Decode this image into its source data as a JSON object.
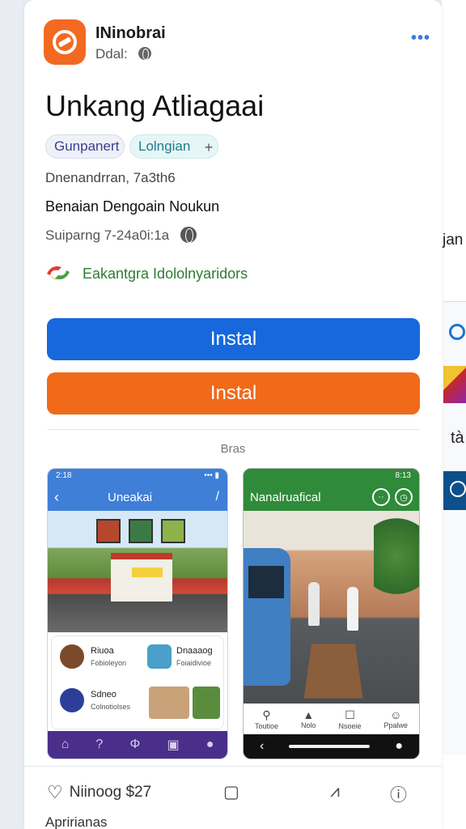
{
  "developer": {
    "name": "INinobrai",
    "subtitle": "Ddal:"
  },
  "menu": {
    "more_icon": "•••"
  },
  "app": {
    "title": "Unkang Atliagaai"
  },
  "tags": [
    "Gunpanert",
    "Lolngian"
  ],
  "tag_add": "+",
  "info": {
    "line_a": "Dnenandrran, 7a3th6",
    "line_b": "Benaian Dengoain Noukun",
    "line_c": "Suiparng 7-24a0i:1a"
  },
  "partner": {
    "text": "Eakantgra Idololnyaridors"
  },
  "buttons": {
    "primary": "Instal",
    "secondary": "Instal"
  },
  "section": {
    "label": "Bras"
  },
  "screenshot_1": {
    "time": "2:18",
    "signal": "••• ▮",
    "title": "Uneakai",
    "items": [
      {
        "title": "Riuoa",
        "sub": "Fobioleyon"
      },
      {
        "title": "Dnaaaog",
        "sub": "Foiaidivioe"
      },
      {
        "title": "Sdneo",
        "sub": "Colnotiolses"
      }
    ]
  },
  "screenshot_2": {
    "time": "8:13",
    "title": "Nanalruafical",
    "actions": [
      {
        "icon": "⚲",
        "label": "Toutioe"
      },
      {
        "icon": "▲",
        "label": "Nolo"
      },
      {
        "icon": "☐",
        "label": "Nsoeie"
      },
      {
        "icon": "☺",
        "label": "Ppalwe"
      }
    ]
  },
  "footer": {
    "likes": "Niinoog $27",
    "label": "Apririanas"
  },
  "side": {
    "label": "jan",
    "text": "tà"
  },
  "colors": {
    "primary_button": "#1668dc",
    "secondary_button": "#f06a1a",
    "app_icon": "#f26a21",
    "partner_text": "#2e7d32"
  },
  "icons": {
    "app": "app-logo-icon",
    "globe": "globe-icon",
    "more": "more-dots-icon",
    "heart": "heart-icon",
    "bookmark": "bookmark-icon",
    "share": "share-icon",
    "info": "info-icon"
  }
}
